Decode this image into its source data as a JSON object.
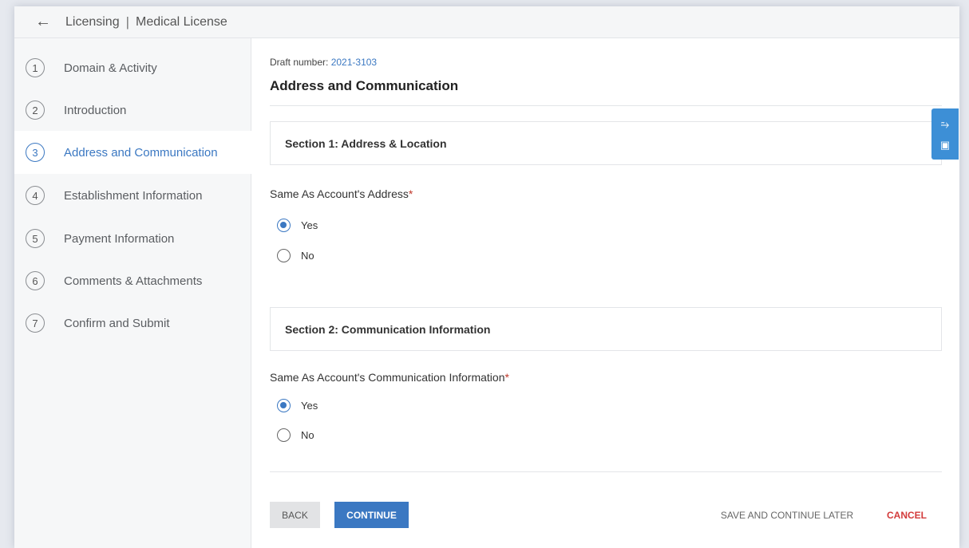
{
  "header": {
    "back_glyph": "←",
    "crumbs": [
      "Licensing",
      "Medical License"
    ],
    "separator": "|"
  },
  "sidebar": {
    "steps": [
      {
        "num": "1",
        "label": "Domain & Activity"
      },
      {
        "num": "2",
        "label": "Introduction"
      },
      {
        "num": "3",
        "label": "Address and Communication",
        "active": true
      },
      {
        "num": "4",
        "label": "Establishment Information"
      },
      {
        "num": "5",
        "label": "Payment Information"
      },
      {
        "num": "6",
        "label": "Comments & Attachments"
      },
      {
        "num": "7",
        "label": "Confirm and Submit"
      }
    ]
  },
  "main": {
    "draft_label": "Draft number:",
    "draft_number": "2021-3103",
    "title": "Address and Communication",
    "section1": {
      "title": "Section 1: Address & Location",
      "question": "Same As Account's Address",
      "required_mark": "*",
      "options": [
        {
          "label": "Yes",
          "selected": true
        },
        {
          "label": "No",
          "selected": false
        }
      ]
    },
    "section2": {
      "title": "Section 2: Communication Information",
      "question": "Same As Account's Communication Information",
      "required_mark": "*",
      "options": [
        {
          "label": "Yes",
          "selected": true
        },
        {
          "label": "No",
          "selected": false
        }
      ]
    },
    "buttons": {
      "back": "BACK",
      "continue": "CONTINUE",
      "save_later": "SAVE AND CONTINUE LATER",
      "cancel": "CANCEL"
    }
  },
  "widget": {
    "icons": [
      "accessibility-icon",
      "chat-icon"
    ],
    "accessibility_glyph": "⥲",
    "chat_glyph": "▣"
  },
  "colors": {
    "accent": "#3b78c2",
    "cancel": "#d33a3a",
    "required": "#c0392b",
    "widget": "#3d8fd6"
  }
}
